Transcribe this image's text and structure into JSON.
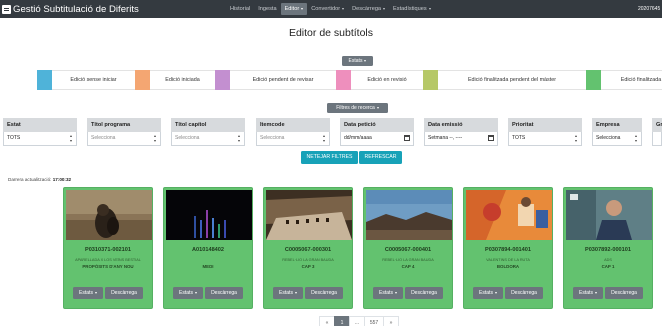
{
  "app": {
    "title": "Gestió Subtitulació de Diferits",
    "user": "20207645"
  },
  "nav": {
    "items": [
      {
        "label": "Historial",
        "dropdown": false,
        "active": false
      },
      {
        "label": "Ingesta",
        "dropdown": false,
        "active": false
      },
      {
        "label": "Editor",
        "dropdown": true,
        "active": true
      },
      {
        "label": "Convertidor",
        "dropdown": true,
        "active": false
      },
      {
        "label": "Descàrrega",
        "dropdown": true,
        "active": false
      },
      {
        "label": "Estadístiques",
        "dropdown": true,
        "active": false
      }
    ]
  },
  "page_title": "Editor de subtítols",
  "states_button": "Estats",
  "legend": [
    {
      "label": "Edició sense iniciar",
      "color": "#4fb3d9"
    },
    {
      "label": "Edició iniciada",
      "color": "#f4a672"
    },
    {
      "label": "Edició pendent de revisar",
      "color": "#c38fd0"
    },
    {
      "label": "Edició en revisió",
      "color": "#ee8fbd"
    },
    {
      "label": "Edició finalitzada pendent del màster",
      "color": "#b6c867"
    },
    {
      "label": "Edició finalitzada",
      "color": "#63c26f"
    }
  ],
  "filters_button": "Filtres de recerca",
  "filters": [
    {
      "label": "Estat",
      "value": "TOTS",
      "control": "select"
    },
    {
      "label": "Títol programa",
      "value": "Selecciona",
      "control": "select"
    },
    {
      "label": "Títol capítol",
      "value": "Selecciona",
      "control": "select"
    },
    {
      "label": "Itemcode",
      "value": "Selecciona",
      "control": "select"
    },
    {
      "label": "Data petició",
      "value": "dd/mm/aaaa",
      "control": "date"
    },
    {
      "label": "Data emissió",
      "value": "Setmana --, ----",
      "control": "week"
    },
    {
      "label": "Prioritat",
      "value": "TOTS",
      "control": "select"
    },
    {
      "label": "Empresa",
      "value": "Selecciona",
      "control": "select"
    },
    {
      "label": "Gr",
      "value": "",
      "control": "select"
    }
  ],
  "actions": {
    "clear": "NETEJAR FILTRES",
    "refresh": "REFRESCAR"
  },
  "last_update": {
    "label": "Darrera actualització:",
    "time": "17:00:32"
  },
  "cards": [
    {
      "code": "P0310371-002101",
      "sub1": "APARELLADA X LOS VEÏNS BESTIAL",
      "sub2": "PROPÒSITS D'ANY NOU",
      "state_button": "Estats",
      "download_button": "Descàrrega"
    },
    {
      "code": "A010148402",
      "sub1": "",
      "sub2": "MEDI",
      "state_button": "Estats",
      "download_button": "Descàrrega"
    },
    {
      "code": "C0005067-000301",
      "sub1": "REBEL·LIO LA GRAN BAUDA",
      "sub2": "CAP 3",
      "state_button": "Estats",
      "download_button": "Descàrrega"
    },
    {
      "code": "C0005067-000401",
      "sub1": "REBEL·LIO LA GRAN BAUDA",
      "sub2": "CAP 4",
      "state_button": "Estats",
      "download_button": "Descàrrega"
    },
    {
      "code": "P0307894-001401",
      "sub1": "VALENTINS DE LA RUTA",
      "sub2": "BOLDORA",
      "state_button": "Estats",
      "download_button": "Descàrrega"
    },
    {
      "code": "P0307892-000101",
      "sub1": "ADS",
      "sub2": "CAP 1",
      "state_button": "Estats",
      "download_button": "Descàrrega"
    }
  ],
  "pagination": {
    "prev": "«",
    "current": "1",
    "ellipsis": "...",
    "last": "557",
    "next": "»"
  }
}
